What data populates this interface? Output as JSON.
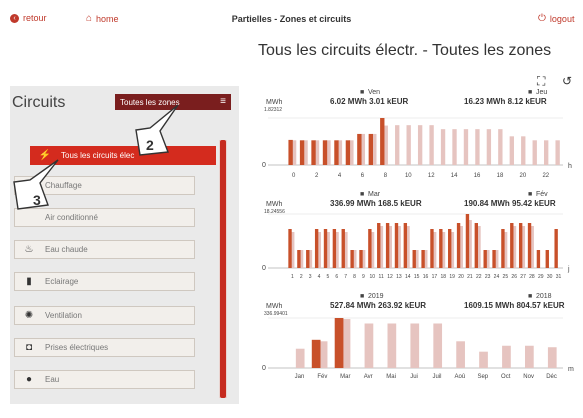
{
  "topbar": {
    "back": "retour",
    "home": "home",
    "title": "Partielles - Zones et circuits",
    "logout": "logout"
  },
  "page_title": "Tous les circuits électr. - Toutes les zones",
  "left": {
    "title": "Circuits",
    "zone_dropdown": "Toutes les zones",
    "items": [
      {
        "label": "Tous les circuits élec",
        "icon": "bolt-icon",
        "glyph": "⚡",
        "active": true
      },
      {
        "label": "Chauffage",
        "icon": "heating-icon",
        "glyph": "",
        "active": false
      },
      {
        "label": "Air conditionné",
        "icon": "ac-icon",
        "glyph": "",
        "active": false
      },
      {
        "label": "Eau chaude",
        "icon": "hot-water-icon",
        "glyph": "♨",
        "active": false
      },
      {
        "label": "Eclairage",
        "icon": "lighting-icon",
        "glyph": "▮",
        "active": false
      },
      {
        "label": "Ventilation",
        "icon": "fan-icon",
        "glyph": "✺",
        "active": false
      },
      {
        "label": "Prises électriques",
        "icon": "plug-icon",
        "glyph": "◘",
        "active": false
      },
      {
        "label": "Eau",
        "icon": "water-drop-icon",
        "glyph": "●",
        "active": false
      }
    ],
    "callouts": [
      "2",
      "3"
    ]
  },
  "chart_data": [
    {
      "type": "bar",
      "unit": "MWh",
      "ymax_label": "1.82312",
      "x_unit": "h",
      "legend": [
        {
          "name": "Ven",
          "summary": "6.02 MWh 3.01 kEUR",
          "color": "#c8502a"
        },
        {
          "name": "Jeu",
          "summary": "16.23 MWh 8.12 kEUR",
          "color": "#8b1a1a"
        }
      ],
      "categories": [
        "0",
        "1",
        "2",
        "3",
        "4",
        "5",
        "6",
        "7",
        "8",
        "9",
        "10",
        "11",
        "12",
        "13",
        "14",
        "15",
        "16",
        "17",
        "18",
        "19",
        "20",
        "21",
        "22",
        "23"
      ],
      "x_ticks": [
        "0",
        "2",
        "4",
        "6",
        "8",
        "10",
        "12",
        "14",
        "16",
        "18",
        "20",
        "22"
      ],
      "series": [
        {
          "name": "Ven",
          "values": [
            0.63,
            0.62,
            0.62,
            0.62,
            0.62,
            0.62,
            0.78,
            0.78,
            1.18,
            0,
            0,
            0,
            0,
            0,
            0,
            0,
            0,
            0,
            0,
            0,
            0,
            0,
            0,
            0
          ]
        },
        {
          "name": "Jeu",
          "values": [
            0.62,
            0.62,
            0.62,
            0.62,
            0.62,
            0.62,
            0.78,
            0.78,
            0.99,
            1.0,
            1.0,
            1.0,
            1.0,
            0.9,
            0.9,
            0.9,
            0.9,
            0.9,
            0.9,
            0.72,
            0.72,
            0.62,
            0.62,
            0.62
          ]
        }
      ]
    },
    {
      "type": "bar",
      "unit": "MWh",
      "ymax_label": "18.24556",
      "x_unit": "j",
      "legend": [
        {
          "name": "Mar",
          "summary": "336.99 MWh 168.5 kEUR",
          "color": "#c8502a"
        },
        {
          "name": "Fév",
          "summary": "190.84 MWh 95.42 kEUR",
          "color": "#8b1a1a"
        }
      ],
      "categories": [
        "1",
        "2",
        "3",
        "4",
        "5",
        "6",
        "7",
        "8",
        "9",
        "10",
        "11",
        "12",
        "13",
        "14",
        "15",
        "16",
        "17",
        "18",
        "19",
        "20",
        "21",
        "22",
        "23",
        "24",
        "25",
        "26",
        "27",
        "28",
        "29",
        "30",
        "31"
      ],
      "series": [
        {
          "name": "Mar",
          "values": [
            13,
            6,
            6,
            13,
            13,
            13,
            13,
            6,
            6,
            13,
            15,
            15,
            15,
            15,
            6,
            6,
            13,
            13,
            13,
            15,
            18,
            15,
            6,
            6,
            13,
            15,
            15,
            15,
            6,
            6,
            13
          ]
        },
        {
          "name": "Fév",
          "values": [
            12,
            6,
            6,
            12,
            12,
            12,
            12,
            6,
            6,
            12,
            14,
            14,
            14,
            14,
            6,
            6,
            12,
            12,
            12,
            14,
            16,
            14,
            6,
            6,
            12,
            14,
            14,
            14,
            0,
            0,
            0
          ]
        }
      ]
    },
    {
      "type": "bar",
      "unit": "MWh",
      "ymax_label": "336.99401",
      "x_unit": "m",
      "legend": [
        {
          "name": "2019",
          "summary": "527.84 MWh 263.92 kEUR",
          "color": "#c8502a"
        },
        {
          "name": "2018",
          "summary": "1609.15 MWh 804.57 kEUR",
          "color": "#8b1a1a"
        }
      ],
      "categories": [
        "Jan",
        "Fév",
        "Mar",
        "Avr",
        "Mai",
        "Jui",
        "Juil",
        "Aoû",
        "Sep",
        "Oct",
        "Nov",
        "Déc"
      ],
      "series": [
        {
          "name": "2019",
          "values": [
            0,
            190,
            337,
            0,
            0,
            0,
            0,
            0,
            0,
            0,
            0,
            0
          ]
        },
        {
          "name": "2018",
          "values": [
            130,
            180,
            330,
            300,
            300,
            300,
            300,
            180,
            110,
            150,
            150,
            140
          ]
        }
      ]
    }
  ]
}
